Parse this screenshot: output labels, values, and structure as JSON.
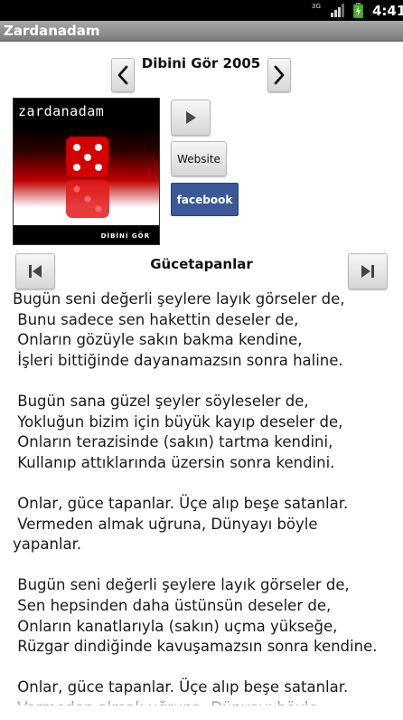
{
  "status_bar": {
    "network": "3G",
    "time": "4:41"
  },
  "app": {
    "title": "Zardanadam"
  },
  "album": {
    "title": "Dibini Gör 2005",
    "cover_band_name": "zardanadam",
    "cover_caption": "DİBİNİ GÖR"
  },
  "actions": {
    "website_label": "Website",
    "facebook_label": "facebook"
  },
  "song": {
    "title": "Gücetapanlar"
  },
  "lyrics": [
    "Bugün seni değerli şeylere layık görseler de,",
    " Bunu sadece sen hakettin deseler de,",
    " Onların gözüyle sakın bakma kendine,",
    " İşleri bittiğinde dayanamazsın sonra haline.",
    "",
    " Bugün sana güzel şeyler söyleseler de,",
    " Yokluğun bizim için büyük kayıp deseler de,",
    " Onların terazisinde (sakın) tartma kendini,",
    " Kullanıp attıklarında üzersin sonra kendini.",
    "",
    " Onlar, güce tapanlar. Üçe alıp beşe satanlar.",
    " Vermeden almak uğruna, Dünyayı böyle",
    "yapanlar.",
    "",
    " Bugün seni değerli şeylere layık görseler de,",
    " Sen hepsinden daha üstünsün deseler de,",
    " Onların kanatlarıyla (sakın) uçma yükseğe,",
    " Rüzgar dindiğinde kavuşamazsın sonra kendine.",
    "",
    " Onlar, güce tapanlar. Üçe alıp beşe satanlar.",
    " Vermeden almak uğruna, Dünyayı böyle"
  ],
  "colors": {
    "facebook": "#3b5998",
    "title_bar": "#8f8f8f",
    "status_bar": "#000000"
  }
}
